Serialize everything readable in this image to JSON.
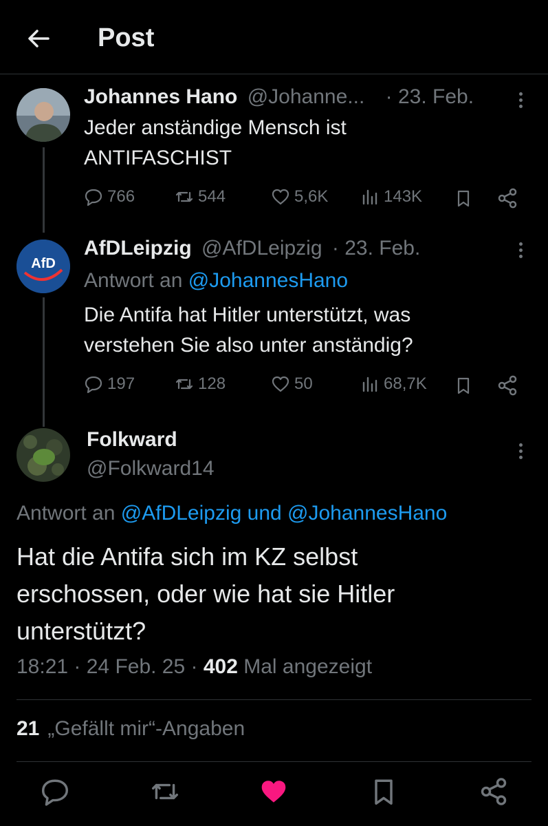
{
  "header": {
    "title": "Post"
  },
  "posts": [
    {
      "display_name": "Johannes Hano",
      "handle": "@Johanne...",
      "date": "· 23. Feb.",
      "text_lines": [
        "Jeder anständige Mensch ist",
        "ANTIFASCHIST"
      ],
      "replies": "766",
      "reposts": "544",
      "likes": "5,6K",
      "views": "143K"
    },
    {
      "display_name": "AfDLeipzig",
      "handle": "@AfDLeipzig",
      "date": "· 23. Feb.",
      "reply_prefix": "Antwort an",
      "reply_to": "@JohannesHano",
      "avatar_label": "AfD",
      "text_lines": [
        "Die Antifa hat Hitler unterstützt, was",
        "verstehen Sie also unter anständig?"
      ],
      "replies": "197",
      "reposts": "128",
      "likes": "50",
      "views": "68,7K"
    }
  ],
  "main_post": {
    "display_name": "Folkward",
    "handle": "@Folkward14",
    "reply_prefix": "Antwort an",
    "reply_to": "@AfDLeipzig und @JohannesHano",
    "text_lines": [
      "Hat die Antifa sich im KZ selbst",
      "erschossen, oder wie hat sie Hitler",
      "unterstützt?"
    ],
    "time": "18:21 · 24 Feb. 25 · ",
    "view_count": "402",
    "view_label": " Mal angezeigt",
    "like_count": "21",
    "like_label": "„Gefällt mir“-Angaben"
  },
  "colors": {
    "accent": "#1d9bf0",
    "like": "#f91880",
    "muted": "#71767b"
  }
}
